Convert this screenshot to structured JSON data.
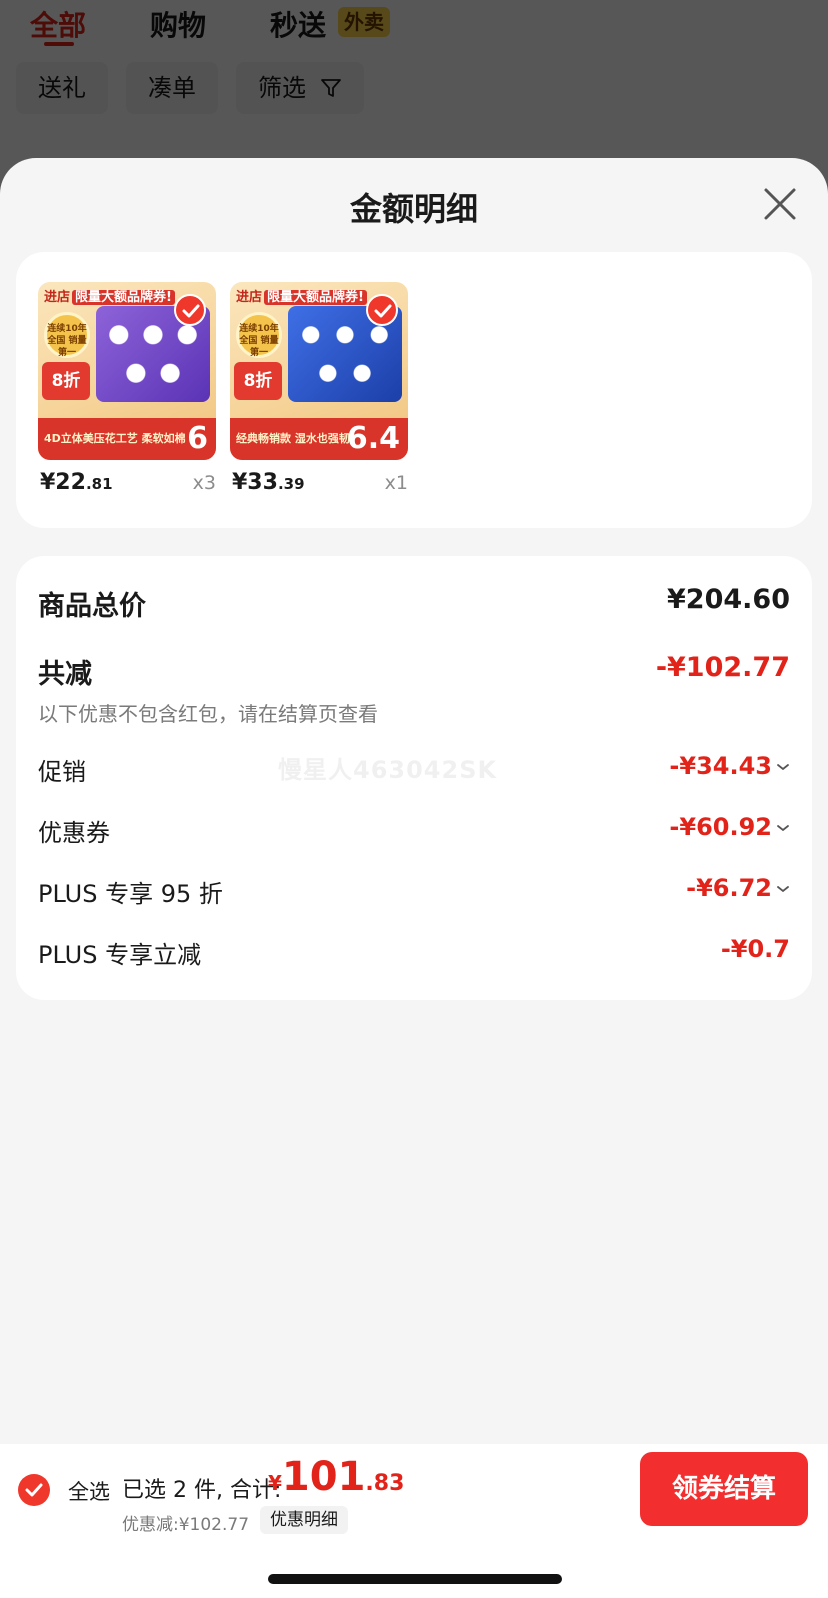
{
  "background_page": {
    "tabs": [
      {
        "label": "全部",
        "active": true
      },
      {
        "label": "购物",
        "active": false
      },
      {
        "label": "秒送",
        "active": false
      }
    ],
    "waimai_badge": "外卖",
    "chips": [
      "送礼",
      "凑单",
      "筛选"
    ]
  },
  "sheet": {
    "title": "金额明细"
  },
  "products": [
    {
      "thumb_head": "进店",
      "thumb_head_tag": "限量大额品牌券!",
      "medal": "连续10年 全国 销量第一",
      "discount_tag": "8折",
      "banner_text": "4D立体美压花工艺 柔软如棉",
      "banner_fold": "6",
      "price_int": "¥22",
      "price_dec": ".81",
      "qty": "x3",
      "goods_style": "purple",
      "checked": true
    },
    {
      "thumb_head": "进店",
      "thumb_head_tag": "限量大额品牌券!",
      "medal": "连续10年 全国 销量第一",
      "discount_tag": "8折",
      "banner_text": "经典畅销款 湿水也强韧",
      "banner_fold": "6.4",
      "price_int": "¥33",
      "price_dec": ".39",
      "qty": "x1",
      "goods_style": "blue",
      "checked": true
    }
  ],
  "summary": {
    "total_label": "商品总价",
    "total_value": "¥204.60",
    "reduce_label": "共减",
    "reduce_value": "-¥102.77",
    "note": "以下优惠不包含红包，请在结算页查看",
    "watermark": "慢星人463042SK",
    "items": [
      {
        "label": "促销",
        "value": "-¥34.43",
        "expandable": true
      },
      {
        "label": "优惠券",
        "value": "-¥60.92",
        "expandable": true
      },
      {
        "label": "PLUS 专享 95 折",
        "value": "-¥6.72",
        "expandable": true
      },
      {
        "label": "PLUS 专享立减",
        "value": "-¥0.7",
        "expandable": false
      }
    ]
  },
  "bottom_bar": {
    "select_all": "全选",
    "selected_text": "已选 2 件, 合计:",
    "total_currency": "¥",
    "total_int": "101",
    "total_dec": ".83",
    "discount_text": "优惠减:¥102.77",
    "detail_chip": "优惠明细",
    "checkout_button": "领券结算"
  },
  "colors": {
    "accent_red": "#e2231a",
    "button_red": "#f22e2e",
    "sheet_bg": "#f5f5f5"
  }
}
